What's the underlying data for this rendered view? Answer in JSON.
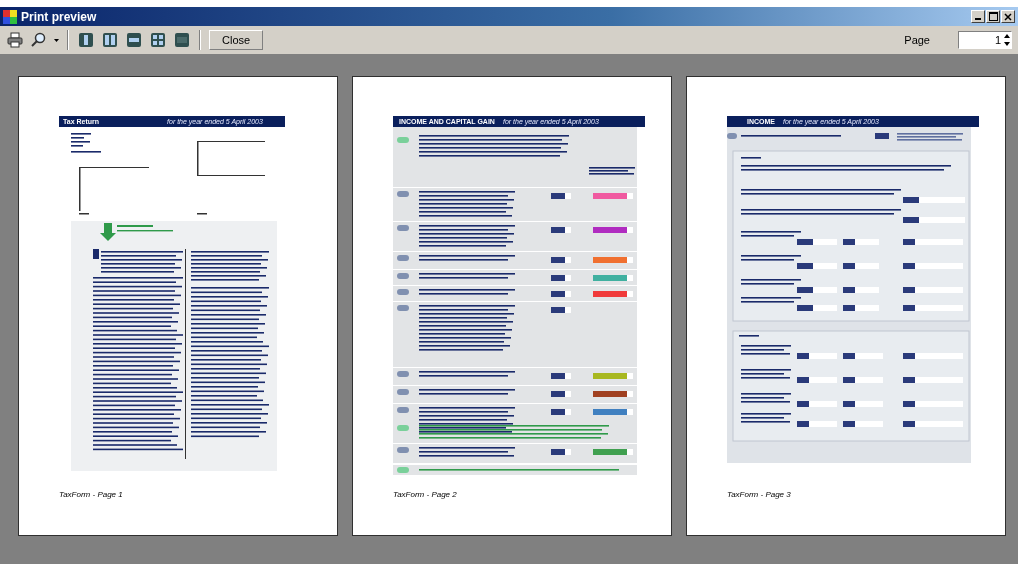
{
  "window": {
    "title": "Print preview"
  },
  "toolbar": {
    "close_button": "Close",
    "page_label": "Page",
    "page_value": "1"
  },
  "pages": [
    {
      "kind": "cover",
      "heading": "Tax Return",
      "subheading": "for the year ended 5 April 2003",
      "footer": "TaxForm - Page 1"
    },
    {
      "kind": "income_capital",
      "heading": "INCOME AND CAPITAL GAIN",
      "subheading": "for the year ended 5 April 2003",
      "footer": "TaxForm - Page 2"
    },
    {
      "kind": "income",
      "heading": "INCOME",
      "subheading": "for the year ended 5 April 2003",
      "footer": "TaxForm - Page 3"
    }
  ]
}
